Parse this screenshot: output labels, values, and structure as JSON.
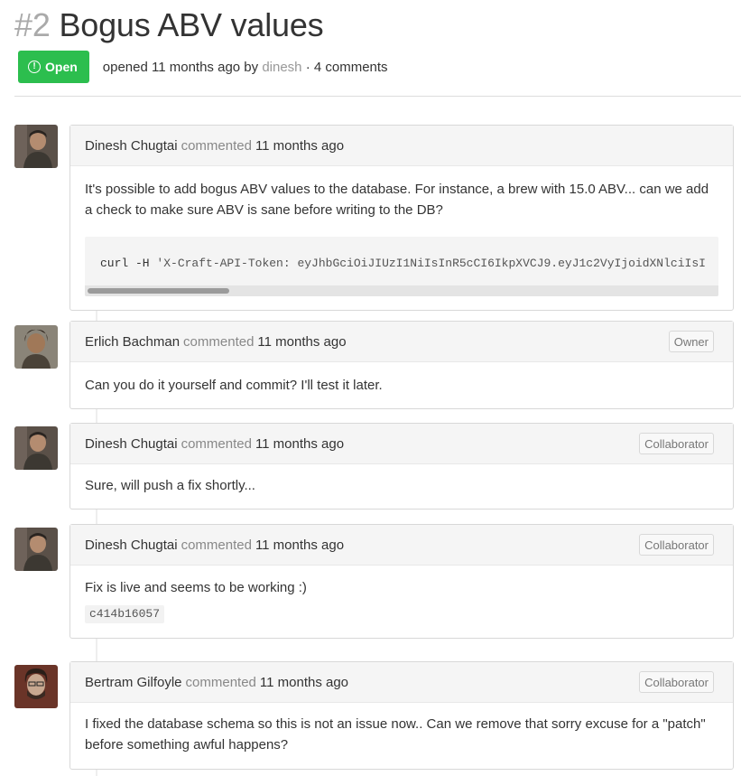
{
  "issue": {
    "number": "#2",
    "title": "Bogus ABV values",
    "state": "Open",
    "meta_prefix": "opened 11 months ago by",
    "author": "dinesh",
    "meta_suffix": "· 4 comments"
  },
  "colors": {
    "open_badge": "#2cbe4e",
    "header_bg": "#f5f5f5",
    "border": "#d8d8d8"
  },
  "comments": [
    {
      "author": "Dinesh Chugtai",
      "action": "commented",
      "time": "11 months ago",
      "role": "",
      "avatar_icon": "person-avatar-icon",
      "body": "It's possible to add bogus ABV values to the database. For instance, a brew with 15.0 ABV... can we add a check to make sure ABV is sane before writing to the DB?",
      "code_cmd": "curl -H",
      "code_str": "'X-Craft-API-Token: eyJhbGciOiJIUzI1NiIsInR5cCI6IkpXVCJ9.eyJ1c2VyIjoidXNlciIsI"
    },
    {
      "author": "Erlich Bachman",
      "action": "commented",
      "time": "11 months ago",
      "role": "Owner",
      "avatar_icon": "person-avatar-icon",
      "body": "Can you do it yourself and commit? I'll test it later."
    },
    {
      "author": "Dinesh Chugtai",
      "action": "commented",
      "time": "11 months ago",
      "role": "Collaborator",
      "avatar_icon": "person-avatar-icon",
      "body": "Sure, will push a fix shortly..."
    },
    {
      "author": "Dinesh Chugtai",
      "action": "commented",
      "time": "11 months ago",
      "role": "Collaborator",
      "avatar_icon": "person-avatar-icon",
      "body": "Fix is live and seems to be working :)",
      "commit_sha": "c414b16057"
    },
    {
      "author": "Bertram Gilfoyle",
      "action": "commented",
      "time": "11 months ago",
      "role": "Collaborator",
      "avatar_icon": "person-avatar-icon",
      "body": "I fixed the database schema so this is not an issue now.. Can we remove that sorry excuse for a \"patch\" before something awful happens?"
    }
  ]
}
